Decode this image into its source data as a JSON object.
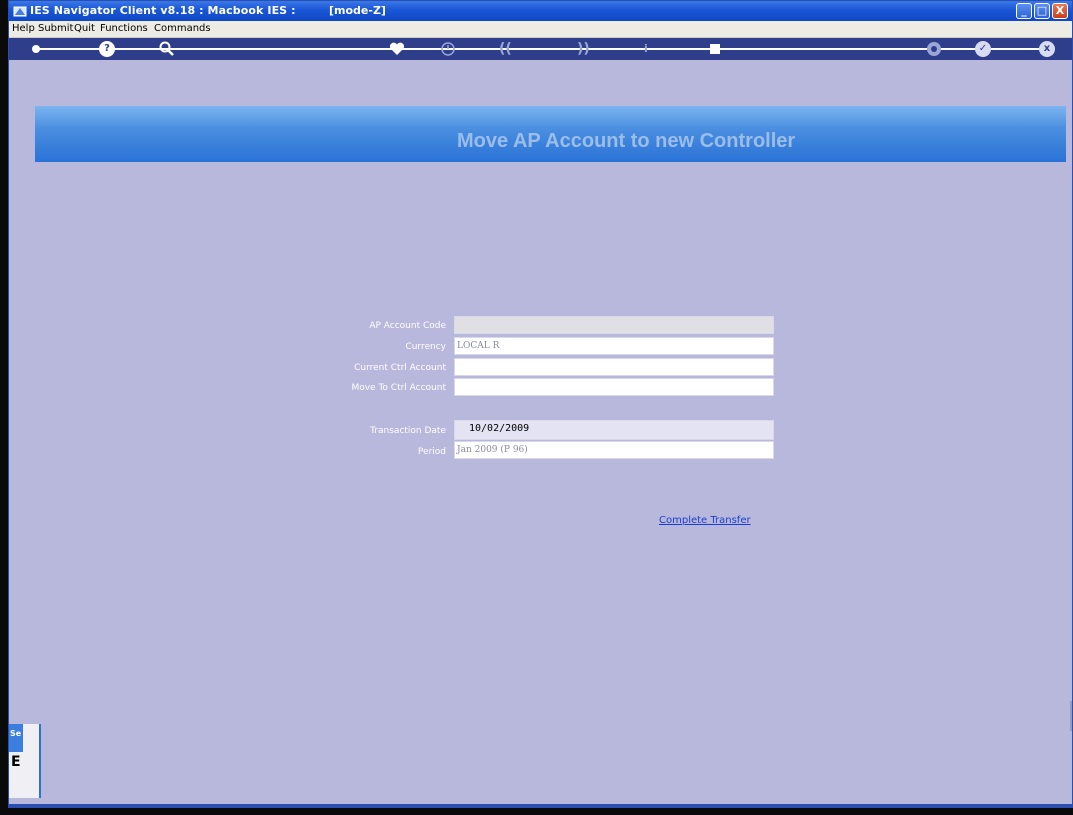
{
  "window": {
    "title": "IES Navigator Client v8.18 : Macbook IES :",
    "mode": "[mode-Z]",
    "controls": {
      "minimize": "_",
      "maximize": "□",
      "close": "X"
    }
  },
  "menu": {
    "items": [
      "Help",
      "Submit",
      "Quit",
      "Functions",
      "Commands"
    ]
  },
  "toolbar": {
    "icons": [
      "key-icon",
      "help-icon",
      "search-icon",
      "heart-icon",
      "clock-icon",
      "rewind-icon",
      "forward-icon",
      "info-icon",
      "stop-icon",
      "settings-icon",
      "check-icon",
      "close-icon"
    ],
    "help_glyph": "?",
    "rewind_glyph": "((",
    "forward_glyph": "))",
    "info_glyph": "i",
    "check_glyph": "✓",
    "close_glyph": "x"
  },
  "banner": {
    "title": "Move AP Account to new Controller"
  },
  "form": {
    "ap_account_code_label": "AP Account Code",
    "ap_account_code_value": "",
    "currency_label": "Currency",
    "currency_value": "LOCAL R",
    "current_ctrl_account_label": "Current Ctrl Account",
    "current_ctrl_account_value": "",
    "move_to_ctrl_account_label": "Move To Ctrl Account",
    "move_to_ctrl_account_value": "",
    "transaction_date_label": "Transaction Date",
    "transaction_date_value": "10/02/2009",
    "period_label": "Period",
    "period_value": "Jan 2009 (P 96)"
  },
  "actions": {
    "complete_transfer": "Complete Transfer"
  },
  "side_panel": {
    "tab_label": "Se",
    "glyph": "E"
  },
  "colors": {
    "background": "#b8b7dc",
    "banner": "#4a8fe0",
    "banner_text": "#9bbde8",
    "link": "#1a3fd0"
  }
}
